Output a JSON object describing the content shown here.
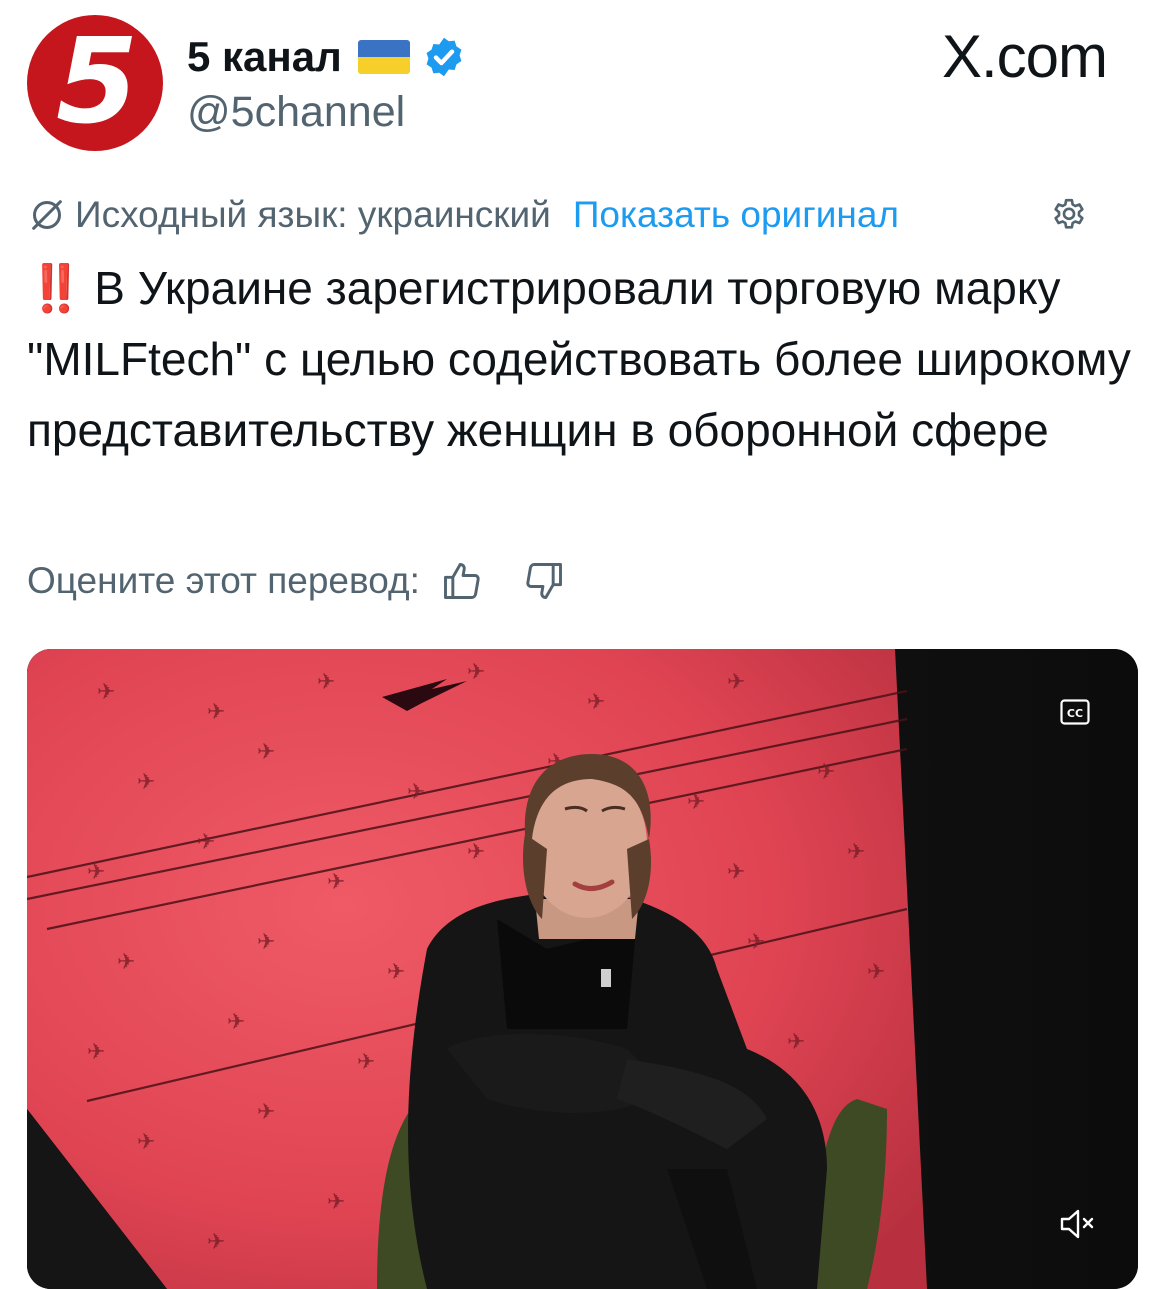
{
  "header": {
    "avatar_glyph": "5",
    "display_name": "5 канал",
    "flag_icon": "ukraine-flag-icon",
    "verified_icon": "verified-badge-icon",
    "handle": "@5channel",
    "site_logo": "X.com"
  },
  "translation": {
    "icon": "translate-slash-icon",
    "source_language": "Исходный язык: украинский",
    "show_original": "Показать оригинал",
    "settings_icon": "gear-icon"
  },
  "tweet": {
    "prefix_emoji": "‼️",
    "text": "В Украине зарегистрировали торговую марку \"MILFtech\" с целью содействовать более широкому представительству женщин в оборонной сфере"
  },
  "rating": {
    "label": "Оцените этот перевод:",
    "thumbs_up_icon": "thumbs-up-icon",
    "thumbs_down_icon": "thumbs-down-icon"
  },
  "media": {
    "type": "video",
    "captions_icon": "cc-icon",
    "mute_icon": "speaker-muted-icon"
  },
  "colors": {
    "brand_red": "#c4161c",
    "link_blue": "#1d9bf0",
    "secondary_text": "#536471",
    "alert_red": "#e8202b",
    "video_backdrop": "#e94f5b"
  }
}
